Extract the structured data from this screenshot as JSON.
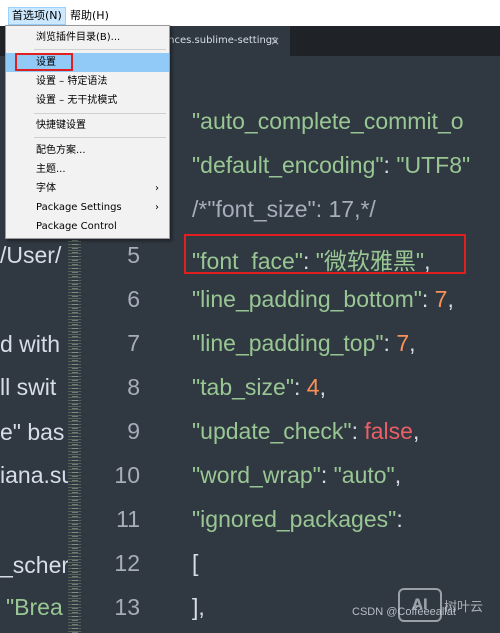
{
  "menubar": {
    "items": [
      {
        "label": "首选项(N)"
      },
      {
        "label": "帮助(H)"
      }
    ]
  },
  "tab": {
    "label": "ences.sublime-settings",
    "close_icon": "×"
  },
  "left_partial_lines": [
    {
      "text": "",
      "style": "p"
    },
    {
      "text": "/User/",
      "style": "p"
    },
    {
      "text": "d with",
      "style": "p"
    },
    {
      "text": "ll swit",
      "style": "p"
    },
    {
      "text": "e\" bas",
      "style": "p"
    },
    {
      "text": "iana.su",
      "style": "p"
    },
    {
      "text": "_scher",
      "style": "p"
    },
    {
      "text": "\"Brea",
      "style": "str"
    }
  ],
  "line_numbers": [
    "5",
    "6",
    "7",
    "8",
    "9",
    "10",
    "11",
    "12",
    "13"
  ],
  "code_lines": [
    [
      {
        "t": "\"auto_complete_commit_o",
        "s": "k"
      }
    ],
    [
      {
        "t": "\"default_encoding\"",
        "s": "k"
      },
      {
        "t": ": ",
        "s": "p"
      },
      {
        "t": "\"UTF8\"",
        "s": "k"
      }
    ],
    [
      {
        "t": "/*\"font_size\": 17,*/",
        "s": "c"
      }
    ],
    [
      {
        "t": "\"font_face\"",
        "s": "k"
      },
      {
        "t": ": ",
        "s": "p"
      },
      {
        "t": "\"微软雅黑\"",
        "s": "k"
      },
      {
        "t": ",",
        "s": "p"
      }
    ],
    [
      {
        "t": "\"line_padding_bottom\"",
        "s": "k"
      },
      {
        "t": ": ",
        "s": "p"
      },
      {
        "t": "7",
        "s": "n"
      },
      {
        "t": ",",
        "s": "p"
      }
    ],
    [
      {
        "t": "\"line_padding_top\"",
        "s": "k"
      },
      {
        "t": ": ",
        "s": "p"
      },
      {
        "t": "7",
        "s": "n"
      },
      {
        "t": ",",
        "s": "p"
      }
    ],
    [
      {
        "t": "\"tab_size\"",
        "s": "k"
      },
      {
        "t": ": ",
        "s": "p"
      },
      {
        "t": "4",
        "s": "n"
      },
      {
        "t": ",",
        "s": "p"
      }
    ],
    [
      {
        "t": "\"update_check\"",
        "s": "k"
      },
      {
        "t": ": ",
        "s": "p"
      },
      {
        "t": "false",
        "s": "b"
      },
      {
        "t": ",",
        "s": "p"
      }
    ],
    [
      {
        "t": "\"word_wrap\"",
        "s": "k"
      },
      {
        "t": ": ",
        "s": "p"
      },
      {
        "t": "\"auto\"",
        "s": "k"
      },
      {
        "t": ",",
        "s": "p"
      }
    ],
    [
      {
        "t": "\"ignored_packages\"",
        "s": "k"
      },
      {
        "t": ":",
        "s": "p"
      }
    ],
    [
      {
        "t": "[",
        "s": "p"
      }
    ],
    [
      {
        "t": "],",
        "s": "p"
      }
    ]
  ],
  "dropdown": {
    "items": [
      {
        "label": "浏览插件目录(B)...",
        "arrow": ""
      },
      {
        "label": "设置",
        "arrow": ""
      },
      {
        "label": "设置 – 特定语法",
        "arrow": ""
      },
      {
        "label": "设置 – 无干扰模式",
        "arrow": ""
      },
      {
        "label": "快捷键设置",
        "arrow": ""
      },
      {
        "label": "配色方案...",
        "arrow": ""
      },
      {
        "label": "主题...",
        "arrow": ""
      },
      {
        "label": "字体",
        "arrow": "›"
      },
      {
        "label": "Package Settings",
        "arrow": "›"
      },
      {
        "label": "Package Control",
        "arrow": ""
      }
    ]
  },
  "watermark": {
    "csdn": "CSDN @Coffeeeallat",
    "logo": "AI",
    "site": "树叶云"
  },
  "colors": {
    "editor_bg": "#303841",
    "string_green": "#99c794",
    "number_orange": "#f99157",
    "false_red": "#ec5f67",
    "highlight_red": "#e02020",
    "menu_hover": "#91c9f7"
  }
}
